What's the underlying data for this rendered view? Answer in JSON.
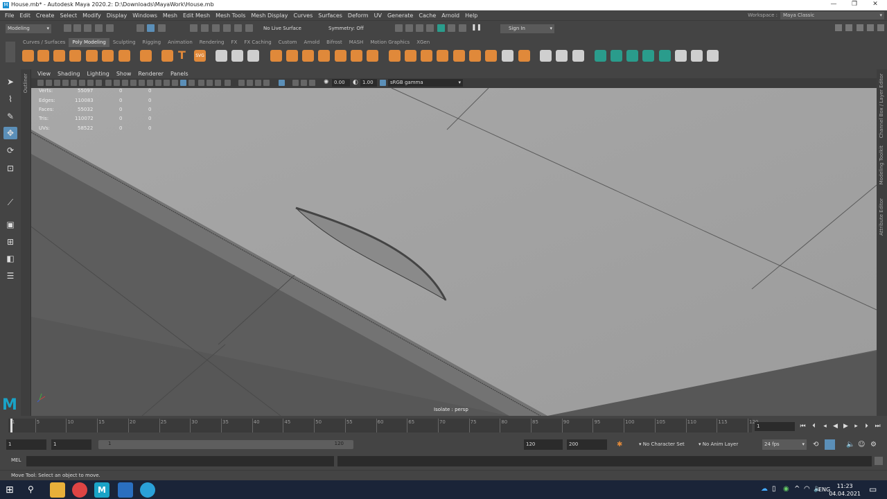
{
  "window": {
    "title": "House.mb* - Autodesk Maya 2020.2: D:\\Downloads\\MayaWork\\House.mb",
    "icon": "maya-icon",
    "controls": [
      "—",
      "❐",
      "✕"
    ]
  },
  "menubar": [
    "File",
    "Edit",
    "Create",
    "Select",
    "Modify",
    "Display",
    "Windows",
    "Mesh",
    "Edit Mesh",
    "Mesh Tools",
    "Mesh Display",
    "Curves",
    "Surfaces",
    "Deform",
    "UV",
    "Generate",
    "Cache",
    "Arnold",
    "Help"
  ],
  "workspace": {
    "label": "Workspace :",
    "value": "Maya Classic"
  },
  "statusline": {
    "mode": "Modeling",
    "live_surface": "No Live Surface",
    "symmetry": "Symmetry: Off",
    "sign_in": "Sign In"
  },
  "shelf": {
    "tabs": [
      "Curves / Surfaces",
      "Poly Modeling",
      "Sculpting",
      "Rigging",
      "Animation",
      "Rendering",
      "FX",
      "FX Caching",
      "Custom",
      "Arnold",
      "Bifrost",
      "MASH",
      "Motion Graphics",
      "XGen"
    ],
    "active_tab": "Poly Modeling"
  },
  "panel": {
    "menus": [
      "View",
      "Shading",
      "Lighting",
      "Show",
      "Renderer",
      "Panels"
    ],
    "field1": "0.00",
    "field2": "1.00",
    "color_space": "sRGB gamma"
  },
  "hud": {
    "rows": [
      {
        "label": "Verts:",
        "v1": "55097",
        "v2": "0",
        "v3": "0"
      },
      {
        "label": "Edges:",
        "v1": "110083",
        "v2": "0",
        "v3": "0"
      },
      {
        "label": "Faces:",
        "v1": "55032",
        "v2": "0",
        "v3": "0"
      },
      {
        "label": "Tris:",
        "v1": "110072",
        "v2": "0",
        "v3": "0"
      },
      {
        "label": "UVs:",
        "v1": "58522",
        "v2": "0",
        "v3": "0"
      }
    ],
    "isolate": "Isolate : persp"
  },
  "side_tabs": {
    "left": "Outliner",
    "right": [
      "Channel Box / Layer Editor",
      "Modeling Toolkit",
      "Attribute Editor"
    ]
  },
  "timeline": {
    "ticks": [
      "1",
      "5",
      "10",
      "15",
      "20",
      "25",
      "30",
      "35",
      "40",
      "45",
      "50",
      "55",
      "60",
      "65",
      "70",
      "75",
      "80",
      "85",
      "90",
      "95",
      "100",
      "105",
      "110",
      "115",
      "120"
    ],
    "current_frame": "1"
  },
  "range": {
    "start": "1",
    "playback_start": "1",
    "range_start_label": "1",
    "range_end_label": "120",
    "playback_end": "120",
    "end": "200",
    "character_set": "No Character Set",
    "anim_layer": "No Anim Layer",
    "fps": "24 fps"
  },
  "cmdline": {
    "label": "MEL"
  },
  "helpline": {
    "text": "Move Tool: Select an object to move."
  },
  "taskbar": {
    "language": "ENG",
    "time": "11:23",
    "date": "04.04.2021"
  },
  "colors": {
    "accent": "#e0893a",
    "maya_blue": "#1aa3c7",
    "taskbar": "#1a2438"
  }
}
